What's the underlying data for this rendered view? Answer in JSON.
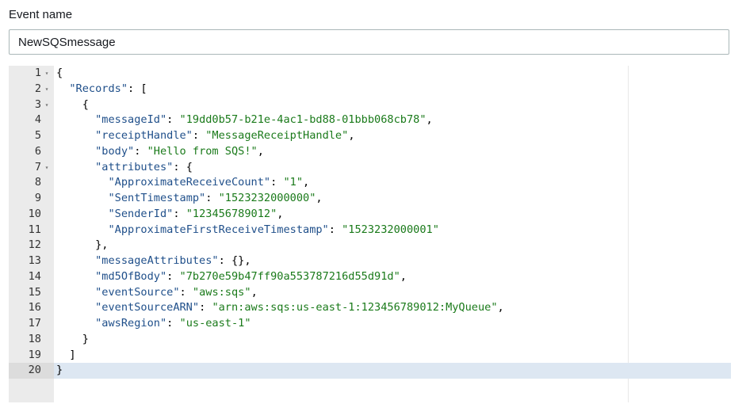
{
  "event": {
    "label": "Event name",
    "value": "NewSQSmessage"
  },
  "editor": {
    "active_line": 20,
    "lines": [
      {
        "n": "1",
        "fold": true,
        "code": [
          {
            "t": "p",
            "v": "{"
          }
        ]
      },
      {
        "n": "2",
        "fold": true,
        "code": [
          {
            "t": "p",
            "v": "  "
          },
          {
            "t": "k",
            "v": "\"Records\""
          },
          {
            "t": "p",
            "v": ": ["
          }
        ]
      },
      {
        "n": "3",
        "fold": true,
        "code": [
          {
            "t": "p",
            "v": "    {"
          }
        ]
      },
      {
        "n": "4",
        "fold": false,
        "code": [
          {
            "t": "p",
            "v": "      "
          },
          {
            "t": "k",
            "v": "\"messageId\""
          },
          {
            "t": "p",
            "v": ": "
          },
          {
            "t": "s",
            "v": "\"19dd0b57-b21e-4ac1-bd88-01bbb068cb78\""
          },
          {
            "t": "p",
            "v": ","
          }
        ]
      },
      {
        "n": "5",
        "fold": false,
        "code": [
          {
            "t": "p",
            "v": "      "
          },
          {
            "t": "k",
            "v": "\"receiptHandle\""
          },
          {
            "t": "p",
            "v": ": "
          },
          {
            "t": "s",
            "v": "\"MessageReceiptHandle\""
          },
          {
            "t": "p",
            "v": ","
          }
        ]
      },
      {
        "n": "6",
        "fold": false,
        "code": [
          {
            "t": "p",
            "v": "      "
          },
          {
            "t": "k",
            "v": "\"body\""
          },
          {
            "t": "p",
            "v": ": "
          },
          {
            "t": "s",
            "v": "\"Hello from SQS!\""
          },
          {
            "t": "p",
            "v": ","
          }
        ]
      },
      {
        "n": "7",
        "fold": true,
        "code": [
          {
            "t": "p",
            "v": "      "
          },
          {
            "t": "k",
            "v": "\"attributes\""
          },
          {
            "t": "p",
            "v": ": {"
          }
        ]
      },
      {
        "n": "8",
        "fold": false,
        "code": [
          {
            "t": "p",
            "v": "        "
          },
          {
            "t": "k",
            "v": "\"ApproximateReceiveCount\""
          },
          {
            "t": "p",
            "v": ": "
          },
          {
            "t": "s",
            "v": "\"1\""
          },
          {
            "t": "p",
            "v": ","
          }
        ]
      },
      {
        "n": "9",
        "fold": false,
        "code": [
          {
            "t": "p",
            "v": "        "
          },
          {
            "t": "k",
            "v": "\"SentTimestamp\""
          },
          {
            "t": "p",
            "v": ": "
          },
          {
            "t": "s",
            "v": "\"1523232000000\""
          },
          {
            "t": "p",
            "v": ","
          }
        ]
      },
      {
        "n": "10",
        "fold": false,
        "code": [
          {
            "t": "p",
            "v": "        "
          },
          {
            "t": "k",
            "v": "\"SenderId\""
          },
          {
            "t": "p",
            "v": ": "
          },
          {
            "t": "s",
            "v": "\"123456789012\""
          },
          {
            "t": "p",
            "v": ","
          }
        ]
      },
      {
        "n": "11",
        "fold": false,
        "code": [
          {
            "t": "p",
            "v": "        "
          },
          {
            "t": "k",
            "v": "\"ApproximateFirstReceiveTimestamp\""
          },
          {
            "t": "p",
            "v": ": "
          },
          {
            "t": "s",
            "v": "\"1523232000001\""
          }
        ]
      },
      {
        "n": "12",
        "fold": false,
        "code": [
          {
            "t": "p",
            "v": "      },"
          }
        ]
      },
      {
        "n": "13",
        "fold": false,
        "code": [
          {
            "t": "p",
            "v": "      "
          },
          {
            "t": "k",
            "v": "\"messageAttributes\""
          },
          {
            "t": "p",
            "v": ": {},"
          }
        ]
      },
      {
        "n": "14",
        "fold": false,
        "code": [
          {
            "t": "p",
            "v": "      "
          },
          {
            "t": "k",
            "v": "\"md5OfBody\""
          },
          {
            "t": "p",
            "v": ": "
          },
          {
            "t": "s",
            "v": "\"7b270e59b47ff90a553787216d55d91d\""
          },
          {
            "t": "p",
            "v": ","
          }
        ]
      },
      {
        "n": "15",
        "fold": false,
        "code": [
          {
            "t": "p",
            "v": "      "
          },
          {
            "t": "k",
            "v": "\"eventSource\""
          },
          {
            "t": "p",
            "v": ": "
          },
          {
            "t": "s",
            "v": "\"aws:sqs\""
          },
          {
            "t": "p",
            "v": ","
          }
        ]
      },
      {
        "n": "16",
        "fold": false,
        "code": [
          {
            "t": "p",
            "v": "      "
          },
          {
            "t": "k",
            "v": "\"eventSourceARN\""
          },
          {
            "t": "p",
            "v": ": "
          },
          {
            "t": "s",
            "v": "\"arn:aws:sqs:us-east-1:123456789012:MyQueue\""
          },
          {
            "t": "p",
            "v": ","
          }
        ]
      },
      {
        "n": "17",
        "fold": false,
        "code": [
          {
            "t": "p",
            "v": "      "
          },
          {
            "t": "k",
            "v": "\"awsRegion\""
          },
          {
            "t": "p",
            "v": ": "
          },
          {
            "t": "s",
            "v": "\"us-east-1\""
          }
        ]
      },
      {
        "n": "18",
        "fold": false,
        "code": [
          {
            "t": "p",
            "v": "    }"
          }
        ]
      },
      {
        "n": "19",
        "fold": false,
        "code": [
          {
            "t": "p",
            "v": "  ]"
          }
        ]
      },
      {
        "n": "20",
        "fold": false,
        "code": [
          {
            "t": "p",
            "v": "}"
          }
        ]
      }
    ]
  }
}
